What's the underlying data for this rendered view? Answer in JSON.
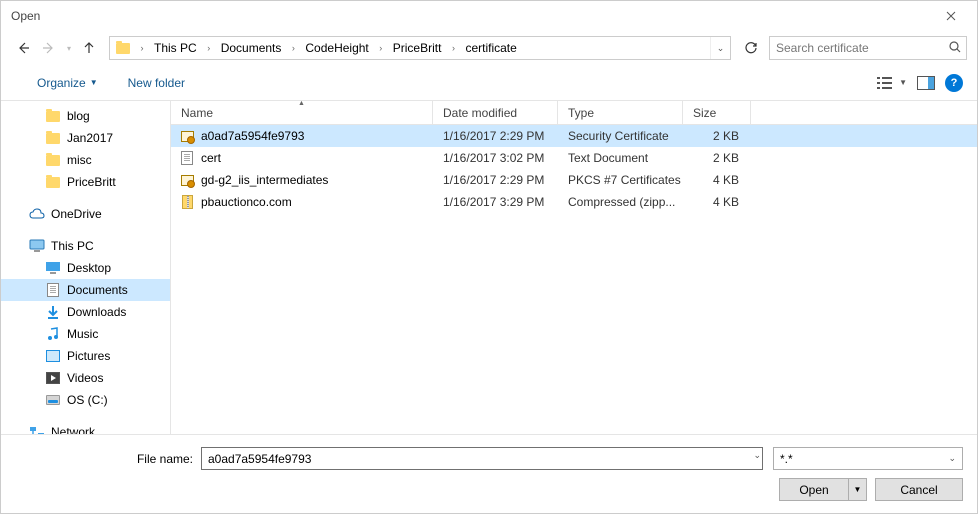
{
  "window": {
    "title": "Open"
  },
  "breadcrumb": [
    "This PC",
    "Documents",
    "CodeHeight",
    "PriceBritt",
    "certificate"
  ],
  "search": {
    "placeholder": "Search certificate"
  },
  "toolbar": {
    "organize": "Organize",
    "newfolder": "New folder"
  },
  "tree": {
    "quick": [
      "blog",
      "Jan2017",
      "misc",
      "PriceBritt"
    ],
    "onedrive": "OneDrive",
    "thispc": "This PC",
    "thispc_items": [
      "Desktop",
      "Documents",
      "Downloads",
      "Music",
      "Pictures",
      "Videos",
      "OS (C:)"
    ],
    "network": "Network"
  },
  "columns": {
    "name": "Name",
    "date": "Date modified",
    "type": "Type",
    "size": "Size"
  },
  "files": [
    {
      "name": "a0ad7a5954fe9793",
      "date": "1/16/2017 2:29 PM",
      "type": "Security Certificate",
      "size": "2 KB",
      "icon": "cert",
      "selected": true
    },
    {
      "name": "cert",
      "date": "1/16/2017 3:02 PM",
      "type": "Text Document",
      "size": "2 KB",
      "icon": "doc"
    },
    {
      "name": "gd-g2_iis_intermediates",
      "date": "1/16/2017 2:29 PM",
      "type": "PKCS #7 Certificates",
      "size": "4 KB",
      "icon": "cert"
    },
    {
      "name": "pbauctionco.com",
      "date": "1/16/2017 3:29 PM",
      "type": "Compressed (zipp...",
      "size": "4 KB",
      "icon": "zip"
    }
  ],
  "bottom": {
    "filename_label": "File name:",
    "filename_value": "a0ad7a5954fe9793",
    "filter": "*.*",
    "open": "Open",
    "cancel": "Cancel"
  }
}
